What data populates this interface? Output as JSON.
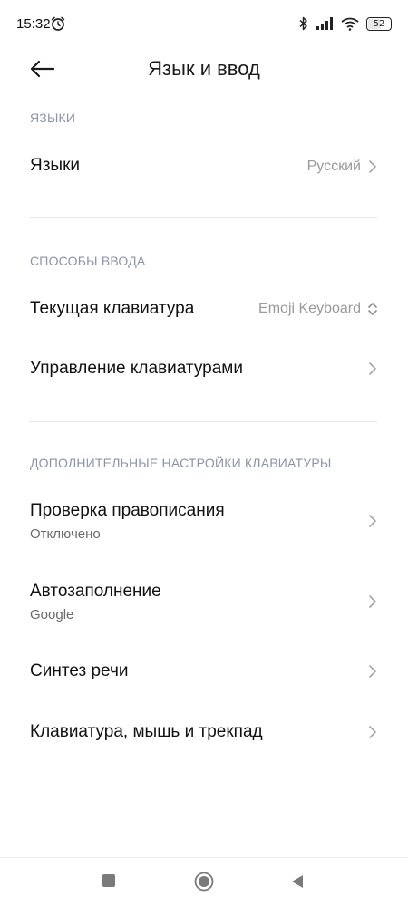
{
  "status_bar": {
    "time": "15:32",
    "battery": "52",
    "battery_level": 0.52,
    "icons": [
      "alarm-icon",
      "bluetooth-icon",
      "signal-icon",
      "wifi-icon",
      "battery-icon"
    ]
  },
  "header": {
    "title": "Язык и ввод",
    "back_icon": "arrow-left-icon"
  },
  "sections": {
    "languages": {
      "label": "ЯЗЫКИ",
      "items": [
        {
          "title": "Языки",
          "value": "Русский",
          "icon": "chevron-right-icon"
        }
      ]
    },
    "input_methods": {
      "label": "СПОСОБЫ ВВОДА",
      "items": [
        {
          "title": "Текущая клавиатура",
          "value": "Emoji Keyboard",
          "icon": "chevron-updown-icon"
        },
        {
          "title": "Управление клавиатурами",
          "icon": "chevron-right-icon"
        }
      ]
    },
    "keyboard_settings": {
      "label": "ДОПОЛНИТЕЛЬНЫЕ НАСТРОЙКИ КЛАВИАТУРЫ",
      "items": [
        {
          "title": "Проверка правописания",
          "subtitle": "Отключено",
          "icon": "chevron-right-icon"
        },
        {
          "title": "Автозаполнение",
          "subtitle": "Google",
          "icon": "chevron-right-icon"
        },
        {
          "title": "Синтез речи",
          "icon": "chevron-right-icon"
        },
        {
          "title": "Клавиатура, мышь и трекпад",
          "icon": "chevron-right-icon"
        }
      ]
    }
  },
  "nav_bar": {
    "icons": [
      "recent-apps-icon",
      "home-icon",
      "back-triangle-icon"
    ]
  },
  "colors": {
    "section_label": "#8a95a8",
    "secondary_value": "#9a9a9a",
    "divider": "#e6e6e6",
    "background": "#ffffff"
  }
}
